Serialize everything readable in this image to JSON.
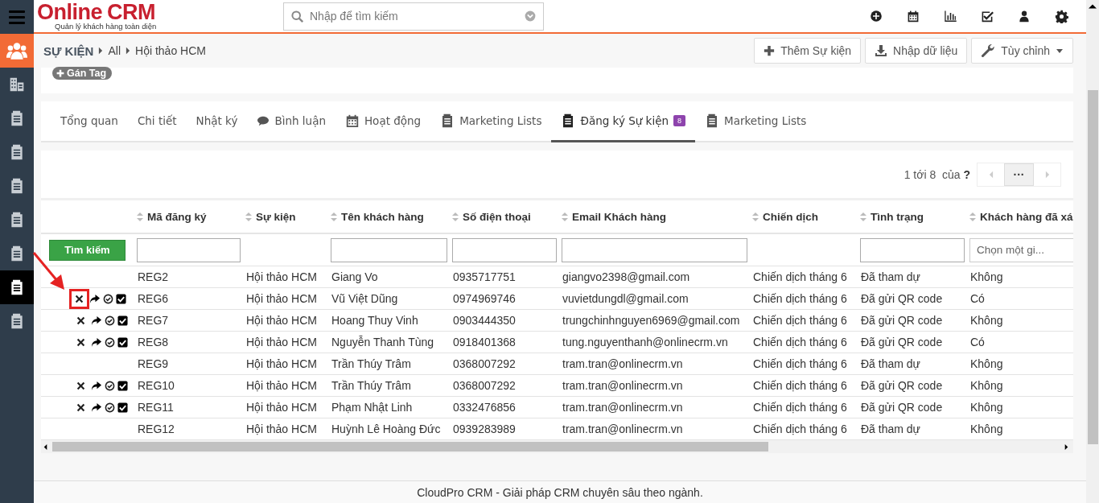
{
  "sidebar": {
    "items": [
      {
        "kind": "people",
        "selected": false
      },
      {
        "kind": "building",
        "selected": false
      },
      {
        "kind": "document",
        "selected": false
      },
      {
        "kind": "document",
        "selected": false
      },
      {
        "kind": "document",
        "selected": false
      },
      {
        "kind": "document",
        "selected": false
      },
      {
        "kind": "document",
        "selected": false
      },
      {
        "kind": "document",
        "selected": true
      },
      {
        "kind": "document",
        "selected": false
      }
    ]
  },
  "header": {
    "logo": {
      "brand": "Online",
      "product": "CRM",
      "tagline": "Quản lý khách hàng toàn diện"
    },
    "search": {
      "placeholder": "Nhập để tìm kiếm"
    },
    "toolbar": [
      {
        "kind": "add"
      },
      {
        "kind": "calendar"
      },
      {
        "kind": "chart"
      },
      {
        "kind": "tasks"
      },
      {
        "kind": "user"
      },
      {
        "kind": "settings"
      }
    ]
  },
  "breadcrumb": [
    "SỰ KIỆN",
    "All",
    "Hội thảo HCM"
  ],
  "actions": [
    {
      "label": "Thêm Sự kiện",
      "kind": "add",
      "dropdown": false
    },
    {
      "label": "Nhập dữ liệu",
      "kind": "import",
      "dropdown": false
    },
    {
      "label": "Tùy chỉnh",
      "kind": "customize",
      "dropdown": true
    }
  ],
  "tag_button": "Gán Tag",
  "tabs": [
    {
      "label": "Tổng quan",
      "kind": "plain",
      "selected": false
    },
    {
      "label": "Chi tiết",
      "kind": "plain",
      "selected": false
    },
    {
      "label": "Nhật ký",
      "kind": "plain",
      "selected": false
    },
    {
      "label": "Bình luận",
      "kind": "comment",
      "selected": false
    },
    {
      "label": "Hoạt động",
      "kind": "calendar",
      "selected": false
    },
    {
      "label": "Marketing Lists",
      "kind": "document",
      "selected": false
    },
    {
      "label": "Đăng ký Sự kiện",
      "kind": "document",
      "badge": "8",
      "selected": true
    },
    {
      "label": "Marketing Lists",
      "kind": "document",
      "selected": false
    }
  ],
  "pager": {
    "range": "1 tới 8  của",
    "total": "?",
    "more": "···"
  },
  "table": {
    "search_button": "Tìm kiếm",
    "columns": [
      {
        "label": "Mã đăng ký",
        "filter": {
          "kind": "text"
        }
      },
      {
        "label": "Sự kiện"
      },
      {
        "label": "Tên khách hàng",
        "filter": {
          "kind": "text"
        }
      },
      {
        "label": "Số điện thoại",
        "filter": {
          "kind": "text"
        }
      },
      {
        "label": "Email Khách hàng",
        "filter": {
          "kind": "text"
        }
      },
      {
        "label": "Chiến dịch"
      },
      {
        "label": "Tình trạng",
        "filter": {
          "kind": "text"
        }
      },
      {
        "label": "Khách hàng đã xá",
        "filter": {
          "kind": "select",
          "placeholder": "Chọn một gi..."
        }
      }
    ],
    "rows": [
      {
        "actions": false,
        "cells": [
          "REG2",
          "Hội thảo HCM",
          "Giang Vo",
          "0935717751",
          "giangvo2398@gmail.com",
          "Chiến dịch tháng 6",
          "Đã tham dự",
          "Không"
        ]
      },
      {
        "actions": true,
        "highlighted": true,
        "cells": [
          "REG6",
          "Hội thảo HCM",
          "Vũ Việt Dũng",
          "0974969746",
          "vuvietdungdl@gmail.com",
          "Chiến dịch tháng 6",
          "Đã gửi QR code",
          "Có"
        ]
      },
      {
        "actions": true,
        "highlighted": false,
        "cells": [
          "REG7",
          "Hội thảo HCM",
          "Hoang Thuy Vinh",
          "0903444350",
          "trungchinhnguyen6969@gmail.com",
          "Chiến dịch tháng 6",
          "Đã gửi QR code",
          "Không"
        ]
      },
      {
        "actions": true,
        "highlighted": false,
        "cells": [
          "REG8",
          "Hội thảo HCM",
          "Nguyễn Thanh Tùng",
          "0918401368",
          "tung.nguyenthanh@onlinecrm.vn",
          "Chiến dịch tháng 6",
          "Đã gửi QR code",
          "Có"
        ]
      },
      {
        "actions": false,
        "cells": [
          "REG9",
          "Hội thảo HCM",
          "Trần Thúy Trâm",
          "0368007292",
          "tram.tran@onlinecrm.vn",
          "Chiến dịch tháng 6",
          "Đã tham dự",
          "Không"
        ]
      },
      {
        "actions": true,
        "highlighted": false,
        "cells": [
          "REG10",
          "Hội thảo HCM",
          "Trần Thúy Trâm",
          "0368007292",
          "tram.tran@onlinecrm.vn",
          "Chiến dịch tháng 6",
          "Đã gửi QR code",
          "Không"
        ]
      },
      {
        "actions": true,
        "highlighted": false,
        "cells": [
          "REG11",
          "Hội thảo HCM",
          "Phạm Nhật Linh",
          "0332476856",
          "tram.tran@onlinecrm.vn",
          "Chiến dịch tháng 6",
          "Đã gửi QR code",
          "Không"
        ]
      },
      {
        "actions": false,
        "cells": [
          "REG12",
          "Hội thảo HCM",
          "Huỳnh Lê Hoàng Đức",
          "0939283989",
          "tram.tran@onlinecrm.vn",
          "Chiến dịch tháng 6",
          "Đã tham dự",
          "Không"
        ]
      }
    ]
  },
  "footer": "CloudPro CRM - Giải pháp CRM chuyên sâu theo ngành."
}
